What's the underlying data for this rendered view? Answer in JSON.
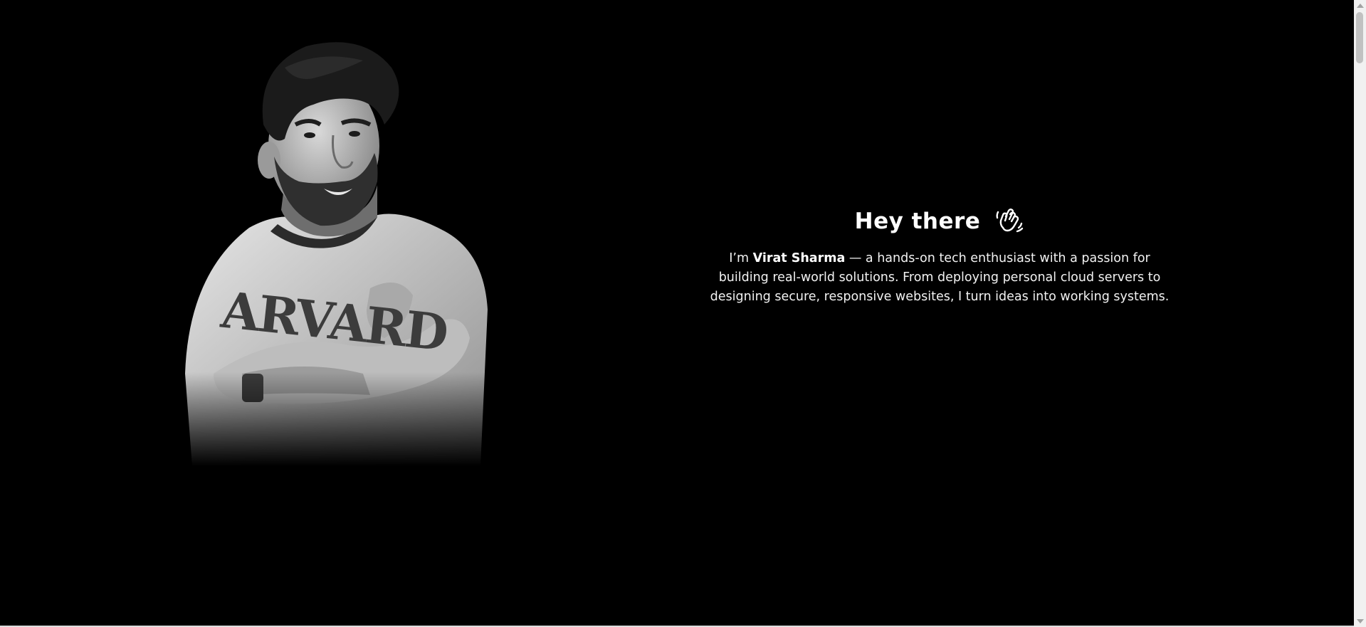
{
  "hero": {
    "greeting": "Hey there",
    "greeting_icon": "waving-hand-icon",
    "intro_prefix": "I’m ",
    "name": "Virat Sharma",
    "intro_suffix": " — a hands-on tech enthusiast with a passion for building real-world solutions. From deploying personal cloud servers to designing secure, responsive websites, I turn ideas into working systems."
  },
  "portrait": {
    "shirt_text": "ARVARD"
  },
  "colors": {
    "background": "#000000",
    "text": "#ffffff"
  }
}
